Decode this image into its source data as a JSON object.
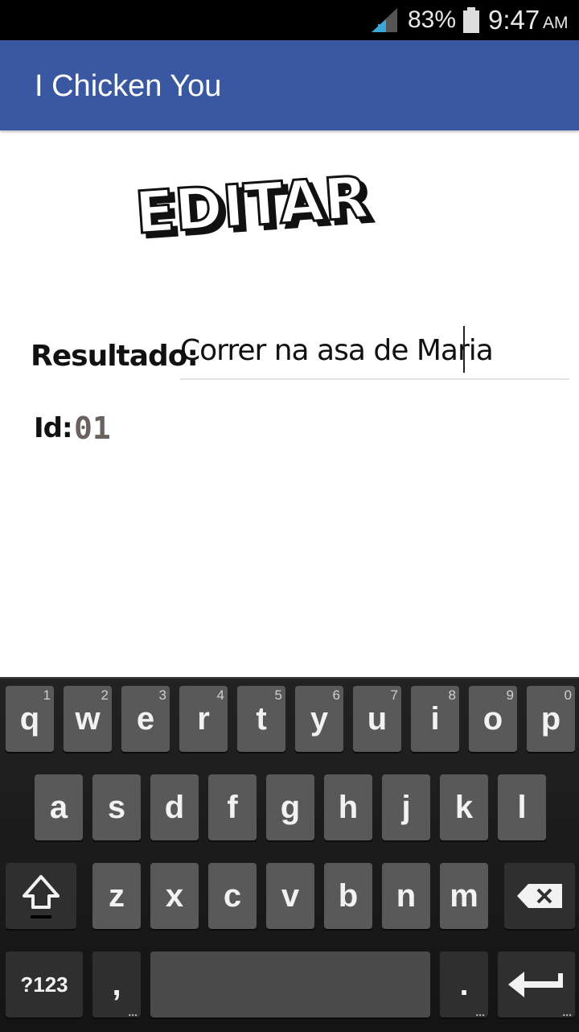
{
  "status_bar": {
    "battery_pct": "83%",
    "time": "9:47",
    "ampm": "AM"
  },
  "app_bar": {
    "title": "I Chicken You"
  },
  "screen": {
    "heading": "EDITAR",
    "resultado_label": "Resultado:",
    "resultado_value": "Correr na asa de Maria",
    "id_label": "Id:",
    "id_value": "01"
  },
  "keyboard": {
    "row1": [
      {
        "key": "q",
        "hint": "1"
      },
      {
        "key": "w",
        "hint": "2"
      },
      {
        "key": "e",
        "hint": "3"
      },
      {
        "key": "r",
        "hint": "4"
      },
      {
        "key": "t",
        "hint": "5"
      },
      {
        "key": "y",
        "hint": "6"
      },
      {
        "key": "u",
        "hint": "7"
      },
      {
        "key": "i",
        "hint": "8"
      },
      {
        "key": "o",
        "hint": "9"
      },
      {
        "key": "p",
        "hint": "0"
      }
    ],
    "row2": [
      "a",
      "s",
      "d",
      "f",
      "g",
      "h",
      "j",
      "k",
      "l"
    ],
    "row3": [
      "z",
      "x",
      "c",
      "v",
      "b",
      "n",
      "m"
    ],
    "symbols_label": "?123",
    "comma_label": ",",
    "period_label": ".",
    "icons": {
      "shift": "shift-icon",
      "backspace": "backspace-icon",
      "enter": "enter-icon"
    }
  },
  "colors": {
    "app_bar": "#3a58a2",
    "status_bar": "#000000",
    "key": "#595959",
    "key_dark": "#2f2f2f"
  }
}
